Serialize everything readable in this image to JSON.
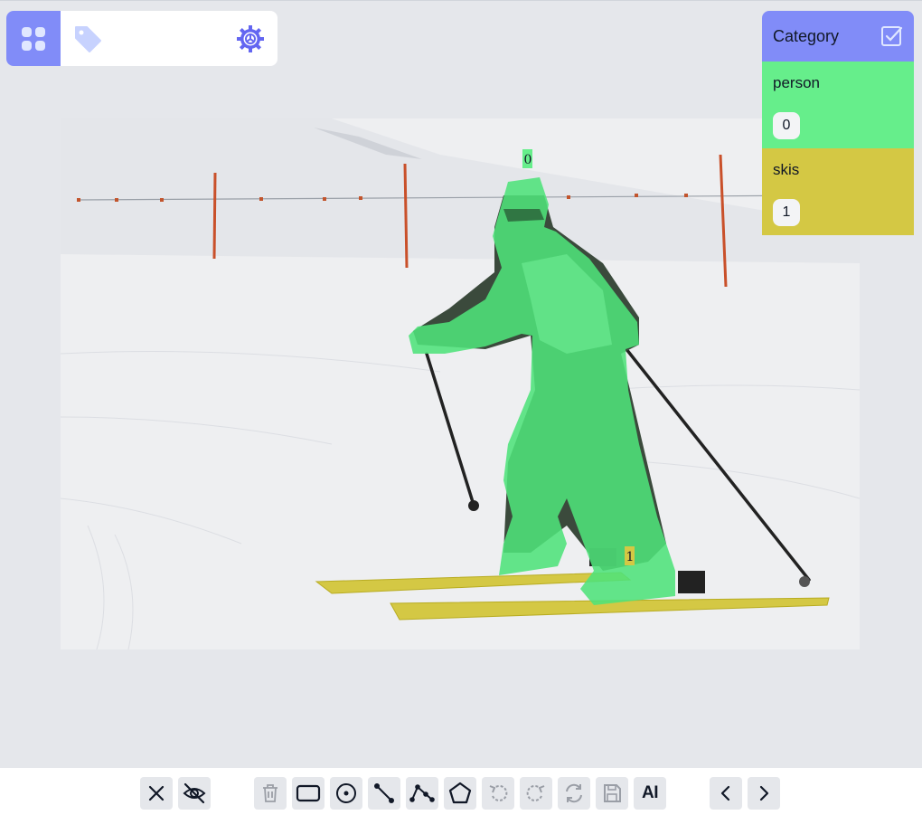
{
  "toolbar_top": {
    "icons": [
      "grid-icon",
      "tag-icon",
      "settings-gear-icon"
    ],
    "accent_color": "#818cf8"
  },
  "category_panel": {
    "title": "Category",
    "header_color": "#818cf8",
    "categories": [
      {
        "name": "person",
        "count": "0",
        "color": "#66ee8b"
      },
      {
        "name": "skis",
        "count": "1",
        "color": "#d4c844"
      }
    ]
  },
  "annotations": {
    "person_label": "0",
    "skis_label": "1"
  },
  "toolbar_bottom": {
    "buttons": [
      "close-icon",
      "hide-eye-icon",
      "delete-icon",
      "rectangle-icon",
      "point-icon",
      "line-icon",
      "polyline-icon",
      "polygon-icon",
      "undo-icon",
      "redo-icon",
      "refresh-icon",
      "save-icon",
      "ai-button",
      "previous-icon",
      "next-icon"
    ],
    "ai_label": "AI"
  }
}
